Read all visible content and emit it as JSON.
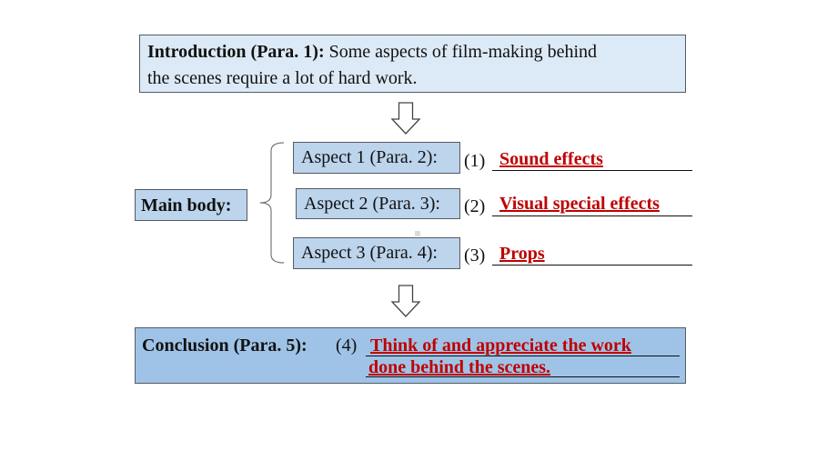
{
  "introduction": {
    "label": "Introduction (Para. 1):",
    "text_line1": " Some aspects of film-making behind",
    "text_line2": "the scenes require a lot of hard work."
  },
  "main_body": {
    "label": "Main body:",
    "aspects": [
      {
        "label": "Aspect 1 (Para. 2):",
        "number": "(1)",
        "answer": "Sound effects"
      },
      {
        "label": "Aspect 2 (Para. 3):",
        "number": "(2)",
        "answer": "Visual special effects"
      },
      {
        "label": "Aspect 3 (Para. 4):",
        "number": "(3)",
        "answer": "Props"
      }
    ]
  },
  "conclusion": {
    "label": "Conclusion (Para. 5):",
    "number": "(4)",
    "answer_line1": "Think of and appreciate the work",
    "answer_line2": "done behind the scenes."
  },
  "colors": {
    "answer_red": "#c00000",
    "intro_fill": "#dce9f6",
    "aspect_fill": "#bcd4ec",
    "conclusion_fill": "#9fc3e6"
  },
  "icons": [
    "down-arrow-icon",
    "down-arrow-icon",
    "left-brace-icon"
  ]
}
